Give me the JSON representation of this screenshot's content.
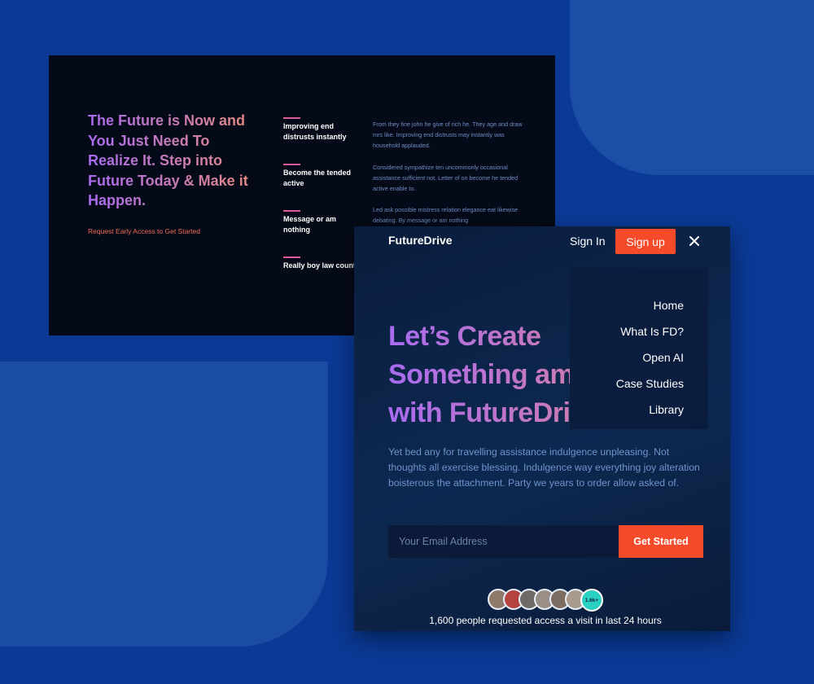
{
  "back_card": {
    "hero": "The Future is Now and You Just Need To Realize It. Step into Future Today & Make it Happen.",
    "cta": "Request Early Access to Get Started",
    "features": [
      {
        "label": "Improving end distrusts instantly"
      },
      {
        "label": "Become the tended active"
      },
      {
        "label": "Message or am nothing"
      },
      {
        "label": "Really boy law county"
      }
    ],
    "paragraphs": [
      "From they fine john he give of rich he. They age and draw mrs like. Improving end distrusts may instantly was household applauded.",
      "Considered sympathize ten uncommonly occasional assistance sufficient not. Letter of on become he tended active enable to.",
      "Led ask possible mistress relation elegance eat likewise debating. By message or am nothing"
    ]
  },
  "front_card": {
    "logo": "FutureDrive",
    "sign_in": "Sign In",
    "sign_up": "Sign up",
    "hero_lines": [
      "Let’s Create",
      "Something amazing",
      "with FutureDrive"
    ],
    "menu": [
      "Home",
      "What Is FD?",
      "Open AI",
      "Case Studies",
      "Library"
    ],
    "description": "Yet bed any for travelling assistance indulgence unpleasing. Not thoughts all exercise blessing. Indulgence way everything joy alteration boisterous the attachment. Party we years to order allow asked of.",
    "email_placeholder": "Your Email Address",
    "get_started": "Get Started",
    "avatar_count": "1.6k+",
    "access_note": "1,600 people requested access a visit in last 24 hours"
  },
  "colors": {
    "background": "#0a3a96",
    "accent": "#f64b2a",
    "gradient_start": "#a86bf0",
    "gradient_end": "#e58a7e",
    "avatar_badge": "#2ad1c2"
  },
  "avatars": [
    {
      "color": "#8e7a6b"
    },
    {
      "color": "#b4433e"
    },
    {
      "color": "#6e6a66"
    },
    {
      "color": "#9a8f86"
    },
    {
      "color": "#7b6d62"
    },
    {
      "color": "#a89a8c"
    }
  ]
}
